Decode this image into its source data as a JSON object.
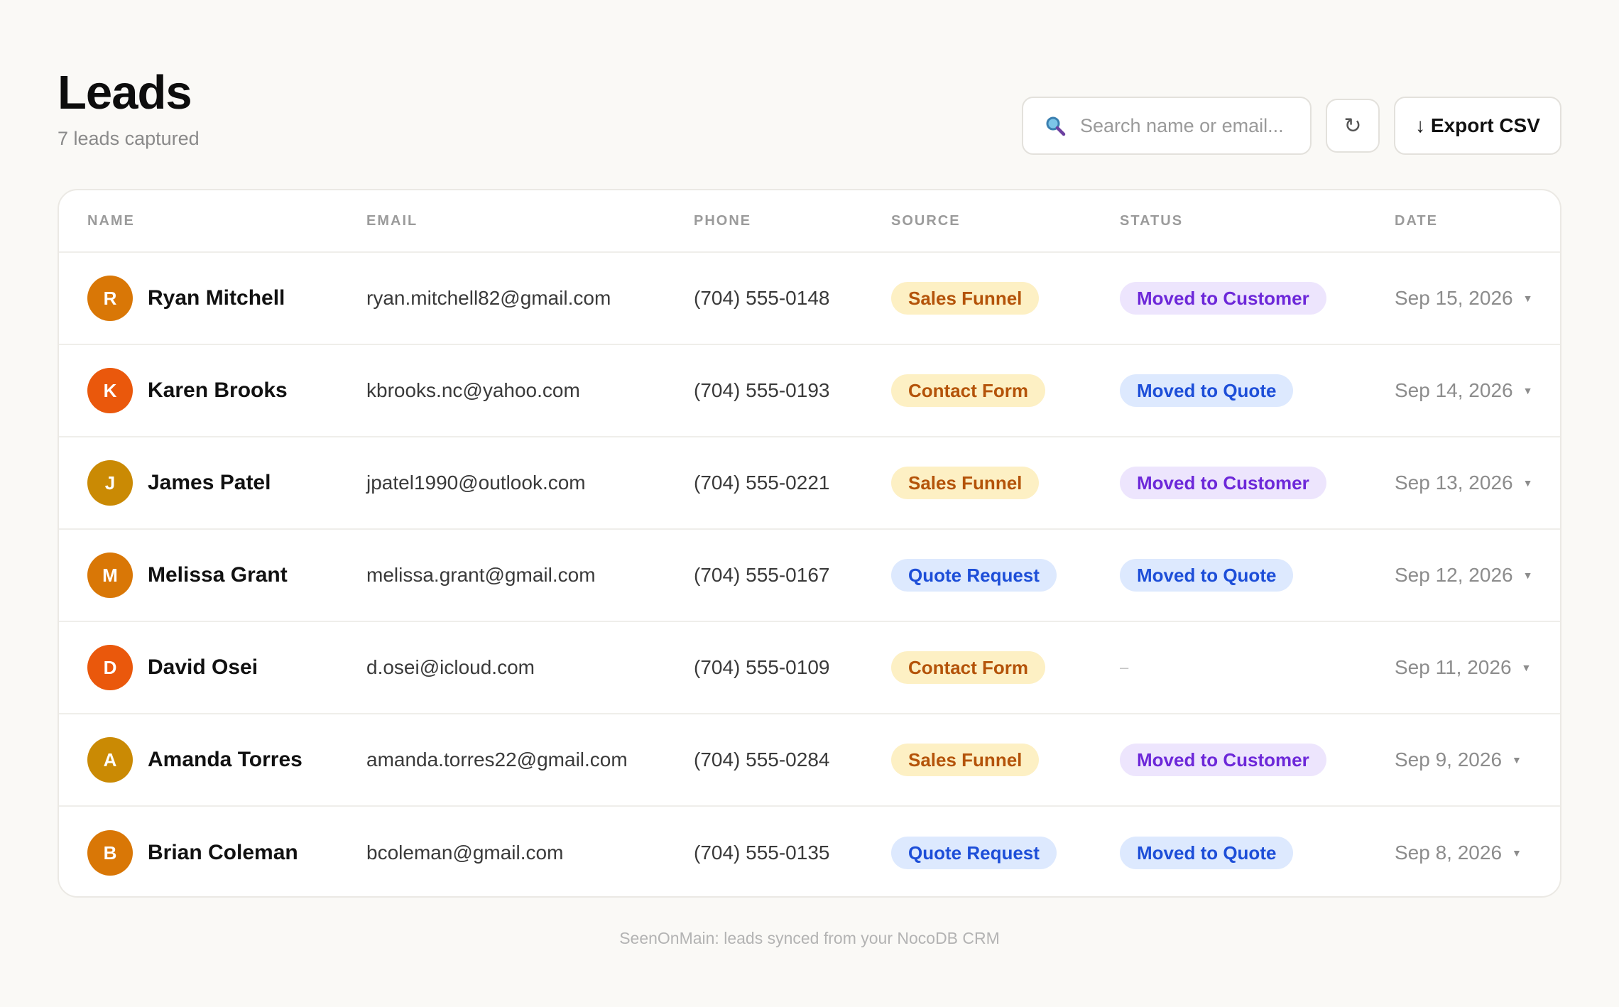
{
  "header": {
    "title": "Leads",
    "subtitle": "7 leads captured"
  },
  "toolbar": {
    "search_placeholder": "Search name or email...",
    "search_icon": "magnifier-icon",
    "refresh_icon": "↻",
    "export_label": "↓ Export CSV"
  },
  "table": {
    "columns": [
      "NAME",
      "EMAIL",
      "PHONE",
      "SOURCE",
      "STATUS",
      "DATE"
    ],
    "rows": [
      {
        "initial": "R",
        "name": "Ryan Mitchell",
        "email": "ryan.mitchell82@gmail.com",
        "phone": "(704) 555-0148",
        "source": "Sales Funnel",
        "status": "Moved to Customer",
        "date": "Sep 15, 2026",
        "avatar_color": "#d97706"
      },
      {
        "initial": "K",
        "name": "Karen Brooks",
        "email": "kbrooks.nc@yahoo.com",
        "phone": "(704) 555-0193",
        "source": "Contact Form",
        "status": "Moved to Quote",
        "date": "Sep 14, 2026",
        "avatar_color": "#ea580c"
      },
      {
        "initial": "J",
        "name": "James Patel",
        "email": "jpatel1990@outlook.com",
        "phone": "(704) 555-0221",
        "source": "Sales Funnel",
        "status": "Moved to Customer",
        "date": "Sep 13, 2026",
        "avatar_color": "#ca8a04"
      },
      {
        "initial": "M",
        "name": "Melissa Grant",
        "email": "melissa.grant@gmail.com",
        "phone": "(704) 555-0167",
        "source": "Quote Request",
        "status": "Moved to Quote",
        "date": "Sep 12, 2026",
        "avatar_color": "#d97706"
      },
      {
        "initial": "D",
        "name": "David Osei",
        "email": "d.osei@icloud.com",
        "phone": "(704) 555-0109",
        "source": "Contact Form",
        "status": "–",
        "date": "Sep 11, 2026",
        "avatar_color": "#ea580c"
      },
      {
        "initial": "A",
        "name": "Amanda Torres",
        "email": "amanda.torres22@gmail.com",
        "phone": "(704) 555-0284",
        "source": "Sales Funnel",
        "status": "Moved to Customer",
        "date": "Sep 9, 2026",
        "avatar_color": "#ca8a04"
      },
      {
        "initial": "B",
        "name": "Brian Coleman",
        "email": "bcoleman@gmail.com",
        "phone": "(704) 555-0135",
        "source": "Quote Request",
        "status": "Moved to Quote",
        "date": "Sep 8, 2026",
        "avatar_color": "#d97706"
      }
    ]
  },
  "badge_colors": {
    "Sales Funnel": {
      "bg": "#fdf0c4",
      "fg": "#b45309"
    },
    "Contact Form": {
      "bg": "#fdf0c4",
      "fg": "#b45309"
    },
    "Quote Request": {
      "bg": "#dde9fe",
      "fg": "#1d4ed8"
    },
    "Moved to Customer": {
      "bg": "#ede5fd",
      "fg": "#6d28d9"
    },
    "Moved to Quote": {
      "bg": "#dde9fe",
      "fg": "#1d4ed8"
    }
  },
  "footer": "SeenOnMain: leads synced from your NocoDB CRM"
}
